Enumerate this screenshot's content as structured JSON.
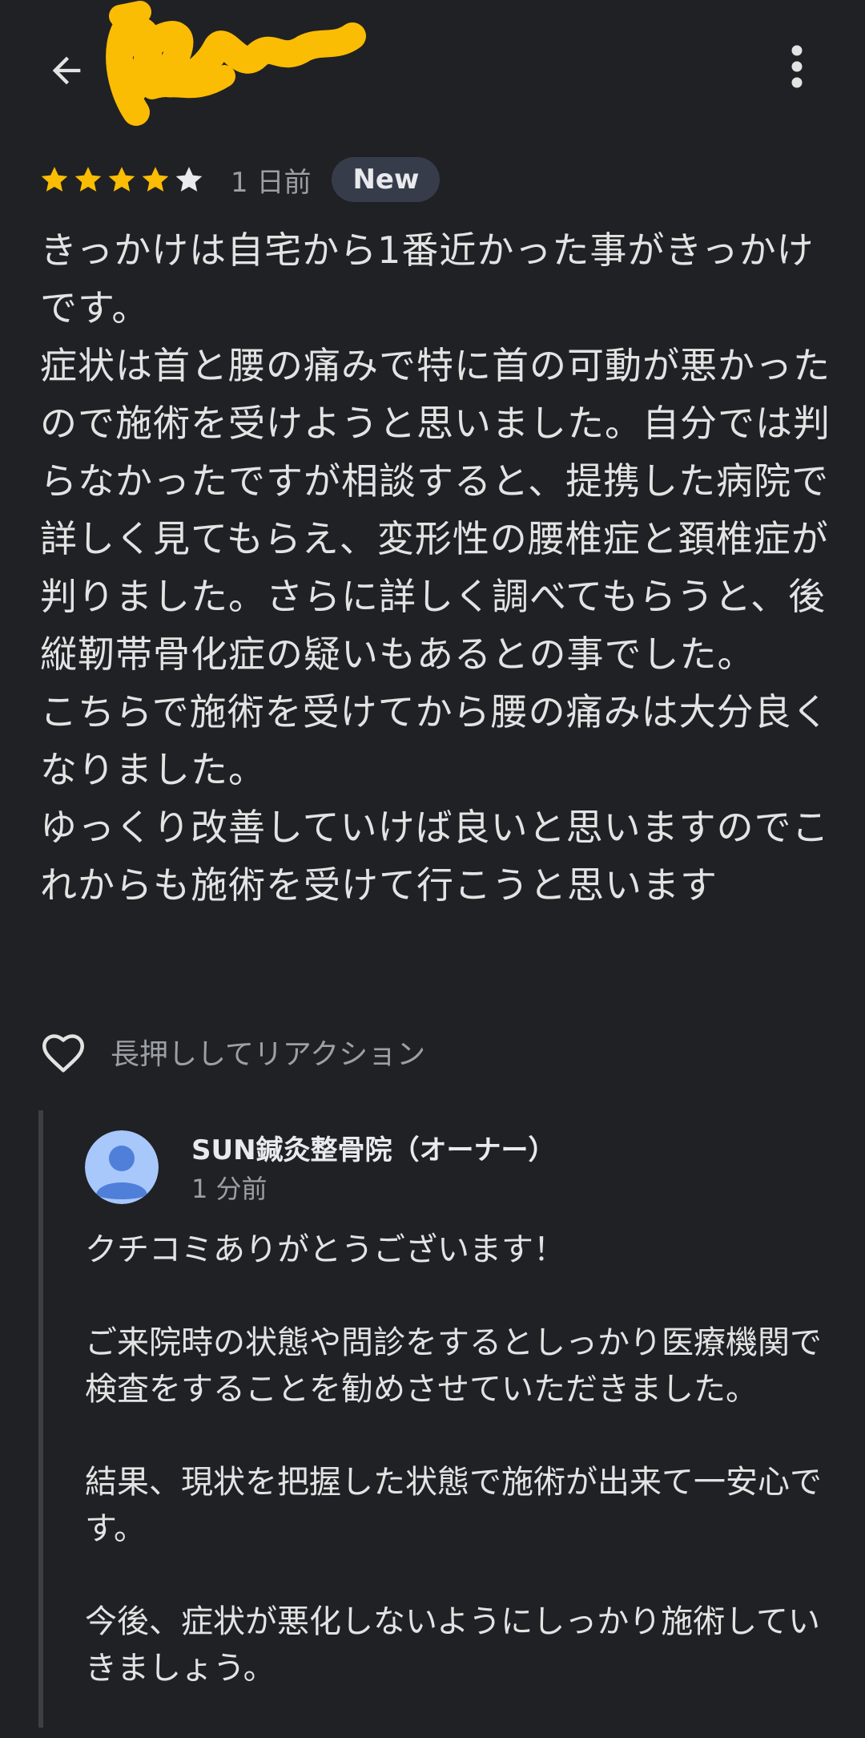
{
  "header": {
    "back_icon": "arrow-back-icon",
    "more_icon": "more-vert-icon",
    "reviewer_name_redacted": true
  },
  "review": {
    "rating": 4,
    "max_rating": 5,
    "time_ago": "1 日前",
    "badge": "New",
    "paragraphs": [
      "きっかけは自宅から1番近かった事がきっかけです。",
      "症状は首と腰の痛みで特に首の可動が悪かったので施術を受けようと思いました。自分では判らなかったですが相談すると、提携した病院で詳しく見てもらえ、変形性の腰椎症と頚椎症が判りました。さらに詳しく調べてもらうと、後縦靭帯骨化症の疑いもあるとの事でした。",
      "こちらで施術を受けてから腰の痛みは大分良くなりました。",
      "ゆっくり改善していけば良いと思いますのでこれからも施術を受けて行こうと思います"
    ]
  },
  "reaction": {
    "icon": "heart-outline-icon",
    "hint": "長押ししてリアクション"
  },
  "owner_reply": {
    "name": "SUN鍼灸整骨院（オーナー）",
    "time_ago": "1 分前",
    "paragraphs": [
      "クチコミありがとうございます！",
      "ご来院時の状態や問診をするとしっかり医療機関で検査をすることを勧めさせていただきました。",
      "結果、現状を把握した状態で施術が出来て一安心です。",
      "今後、症状が悪化しないようにしっかり施術していきましょう。"
    ]
  },
  "colors": {
    "background": "#202124",
    "star_filled": "#fbbc04",
    "star_empty": "#e8eaed",
    "badge_bg": "#373c4b",
    "avatar_bg": "#a8c7fa",
    "avatar_fg": "#4f7fd9",
    "redaction": "#fbbc04"
  }
}
